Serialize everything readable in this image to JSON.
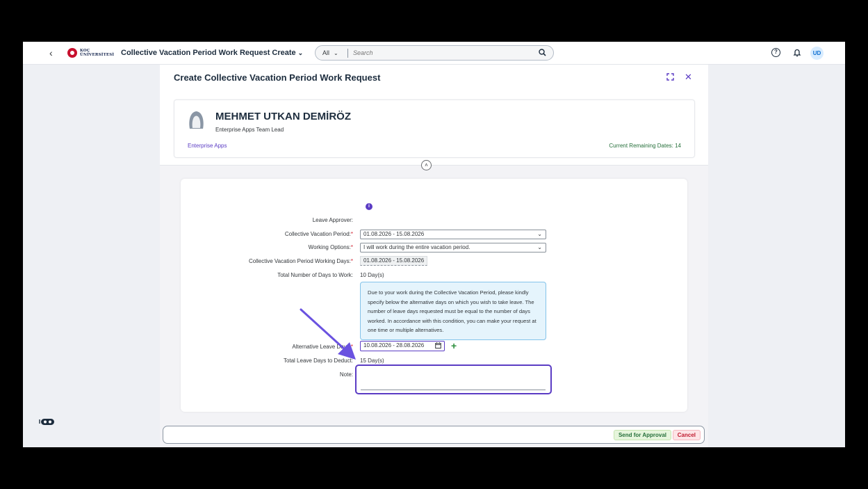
{
  "shell": {
    "logo_line1": "KOÇ",
    "logo_line2": "ÜNİVERSİTESİ",
    "app_title": "Collective Vacation Period Work Request Create",
    "search_scope": "All",
    "search_placeholder": "Search",
    "avatar_initials": "UD"
  },
  "dialog": {
    "title": "Create Collective Vacation Period Work Request",
    "employee": {
      "name": "MEHMET UTKAN DEMİRÖZ",
      "role": "Enterprise Apps Team Lead",
      "department": "Enterprise Apps",
      "remaining": "Current Remaining Dates: 14"
    },
    "form": {
      "leave_approver_label": "Leave Approver:",
      "period_label": "Collective Vacation Period:",
      "period_value": "01.08.2026 - 15.08.2026",
      "working_options_label": "Working Options:",
      "working_options_value": "I will work during the entire vacation period.",
      "working_days_label": "Collective Vacation Period Working Days:",
      "working_days_value": "01.08.2026 - 15.08.2026",
      "total_work_label": "Total Number of Days to Work:",
      "total_work_value": "10 Day(s)",
      "info_text": "Due to your work during the Collective Vacation Period, please kindly specify below the alternative days on which you wish to take leave. The number of leave days requested must be equal to the number of days worked. In accordance with this condition, you can make your request at one time or multiple alternatives.",
      "alt_days_label": "Alternative Leave Days:",
      "alt_days_value": "10.08.2026 - 28.08.2026",
      "total_deduct_label": "Total Leave Days to Deduct:",
      "total_deduct_value": "15 Day(s)",
      "note_label": "Note:",
      "note_value": ""
    },
    "footer": {
      "approve_label": "Send for Approval",
      "cancel_label": "Cancel"
    }
  },
  "colors": {
    "accent": "#5b3cc4",
    "approve": "#256f3a",
    "cancel": "#c0192e"
  }
}
